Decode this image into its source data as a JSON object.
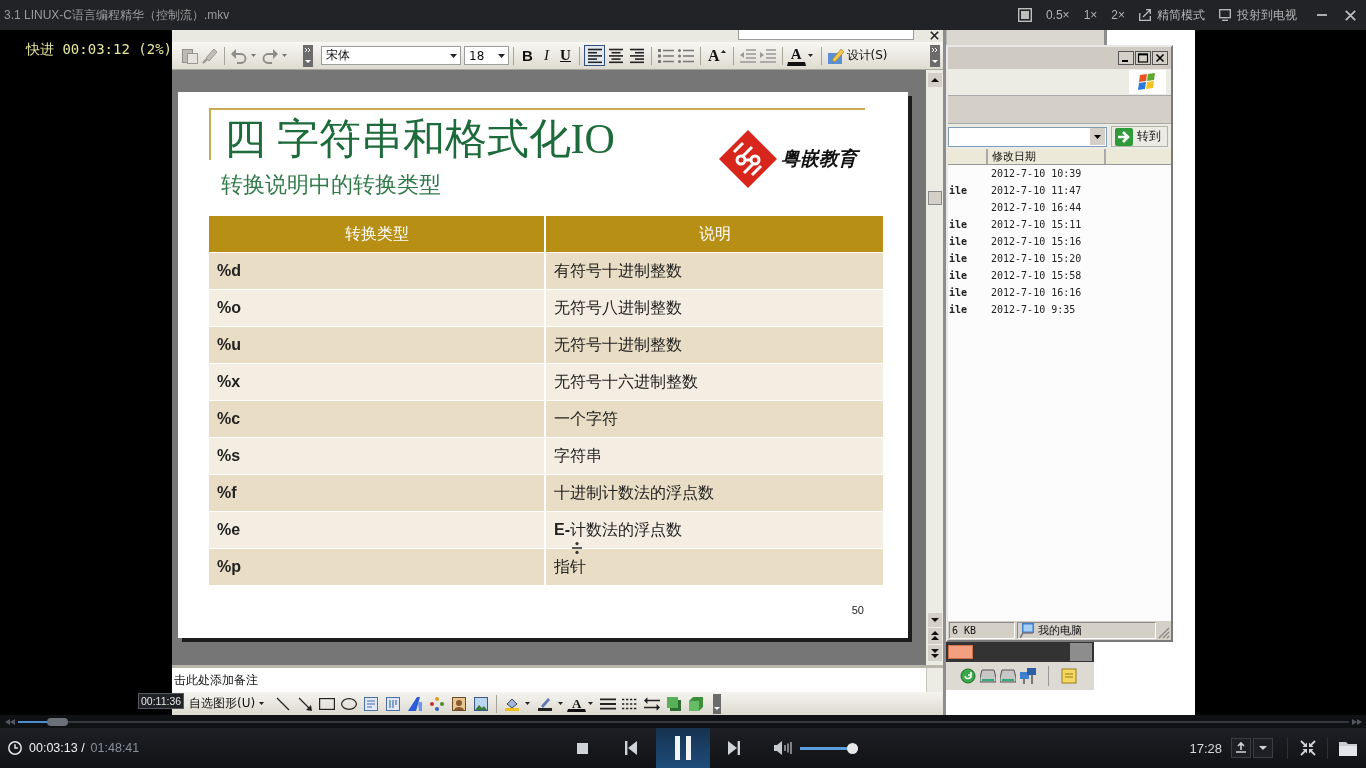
{
  "window": {
    "title": "3.1 LINUX-C语言编程精华（控制流）.mkv",
    "speed_options": [
      {
        "label": "0.5×",
        "selected": false
      },
      {
        "label": "1×",
        "selected": false
      },
      {
        "label": "2×",
        "selected": false
      }
    ],
    "mini_mode": "精简模式",
    "cast": "投射到电视"
  },
  "osd": {
    "text": "快进 00:03:12 (2%)"
  },
  "editor": {
    "toolbar": {
      "font": "宋体",
      "size": "18",
      "styles": [
        "B",
        "I",
        "U"
      ],
      "align": [
        {
          "selected": true
        },
        {
          "selected": false
        },
        {
          "selected": false
        }
      ],
      "grow_font": "A",
      "font_color": "A",
      "design": "设计(S)"
    },
    "slide": {
      "title": "四 字符串和格式化IO",
      "subtitle": "转换说明中的转换类型",
      "logo_text": "粤嵌教育",
      "table": {
        "columns": [
          "转换类型",
          "说明"
        ],
        "rows": [
          [
            "%d",
            "有符号十进制整数"
          ],
          [
            "%o",
            "无符号八进制整数"
          ],
          [
            "%u",
            "无符号十进制整数"
          ],
          [
            "%x",
            "无符号十六进制整数"
          ],
          [
            "%c",
            "一个字符"
          ],
          [
            "%s",
            "字符串"
          ],
          [
            "%f",
            "十进制计数法的浮点数"
          ],
          [
            "%e",
            "**E-**计数法的浮点数"
          ],
          [
            "%p",
            "指针"
          ]
        ]
      },
      "page": "50"
    },
    "notes": "击此处添加备注",
    "drawing_toolbar": {
      "autoshapes": "自选图形(U)",
      "font_color": "A"
    }
  },
  "explorer": {
    "go": "转到",
    "columns": [
      "修改日期"
    ],
    "rows": [
      {
        "modified": "2012-7-10 10:39"
      },
      {
        "column_1": "ile",
        "modified": "2012-7-10 11:47"
      },
      {
        "modified": "2012-7-10 16:44"
      },
      {
        "column_1": "ile",
        "modified": "2012-7-10 15:11"
      },
      {
        "column_1": "ile",
        "modified": "2012-7-10 15:16"
      },
      {
        "column_1": "ile",
        "modified": "2012-7-10 15:20"
      },
      {
        "column_1": "ile",
        "modified": "2012-7-10 15:58"
      },
      {
        "column_1": "ile",
        "modified": "2012-7-10 16:16"
      },
      {
        "column_1": "ile",
        "modified": "2012-7-10 9:35"
      }
    ],
    "status": {
      "size": "6 KB",
      "location": "我的电脑"
    }
  },
  "seek": {
    "level": 0.03,
    "tooltip": "00:11:36"
  },
  "controls": {
    "elapsed": "00:03:13 /",
    "duration": "01:48:41",
    "playing": true,
    "volume": {
      "level": 1
    },
    "clock": "17:28"
  }
}
